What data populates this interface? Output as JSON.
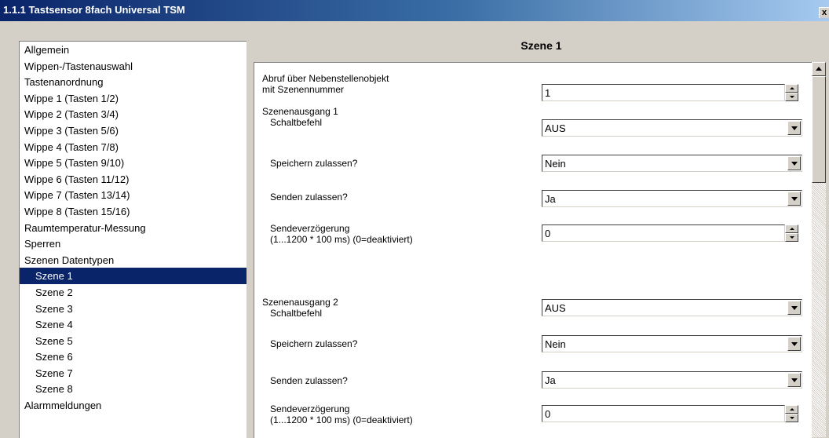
{
  "window": {
    "title": "1.1.1 Tastsensor 8fach Universal TSM",
    "close_glyph": "x"
  },
  "nav": {
    "items": [
      {
        "label": "Allgemein",
        "sub": false
      },
      {
        "label": "Wippen-/Tastenauswahl",
        "sub": false
      },
      {
        "label": "Tastenanordnung",
        "sub": false
      },
      {
        "label": "Wippe 1 (Tasten 1/2)",
        "sub": false
      },
      {
        "label": "Wippe 2 (Tasten 3/4)",
        "sub": false
      },
      {
        "label": "Wippe 3 (Tasten 5/6)",
        "sub": false
      },
      {
        "label": "Wippe 4 (Tasten 7/8)",
        "sub": false
      },
      {
        "label": "Wippe 5 (Tasten 9/10)",
        "sub": false
      },
      {
        "label": "Wippe 6 (Tasten 11/12)",
        "sub": false
      },
      {
        "label": "Wippe 7 (Tasten 13/14)",
        "sub": false
      },
      {
        "label": "Wippe 8 (Tasten 15/16)",
        "sub": false
      },
      {
        "label": "Raumtemperatur-Messung",
        "sub": false
      },
      {
        "label": "Sperren",
        "sub": false
      },
      {
        "label": "Szenen Datentypen",
        "sub": false
      },
      {
        "label": "Szene 1",
        "sub": true,
        "selected": true
      },
      {
        "label": "Szene 2",
        "sub": true
      },
      {
        "label": "Szene 3",
        "sub": true
      },
      {
        "label": "Szene 4",
        "sub": true
      },
      {
        "label": "Szene 5",
        "sub": true
      },
      {
        "label": "Szene 6",
        "sub": true
      },
      {
        "label": "Szene 7",
        "sub": true
      },
      {
        "label": "Szene 8",
        "sub": true
      },
      {
        "label": "Alarmmeldungen",
        "sub": false
      }
    ]
  },
  "page": {
    "heading": "Szene 1"
  },
  "params": {
    "abruf": {
      "line1": "Abruf über Nebenstellenobjekt",
      "line2": "mit Szenennummer",
      "value": "1"
    },
    "ausgang1": {
      "title": "Szenenausgang 1",
      "schalt_label": "Schaltbefehl",
      "schalt_value": "AUS",
      "speichern_label": "Speichern zulassen?",
      "speichern_value": "Nein",
      "senden_label": "Senden zulassen?",
      "senden_value": "Ja",
      "verz_line1": "Sendeverzögerung",
      "verz_line2": "(1...1200 * 100 ms) (0=deaktiviert)",
      "verz_value": "0"
    },
    "ausgang2": {
      "title": "Szenenausgang 2",
      "schalt_label": "Schaltbefehl",
      "schalt_value": "AUS",
      "speichern_label": "Speichern zulassen?",
      "speichern_value": "Nein",
      "senden_label": "Senden zulassen?",
      "senden_value": "Ja",
      "verz_line1": "Sendeverzögerung",
      "verz_line2": "(1...1200 * 100 ms) (0=deaktiviert)",
      "verz_value": "0"
    }
  },
  "colors": {
    "selection": "#0a246a",
    "dialog_bg": "#d4d0c8",
    "title_start": "#0a246a",
    "title_end": "#a6caf0"
  }
}
